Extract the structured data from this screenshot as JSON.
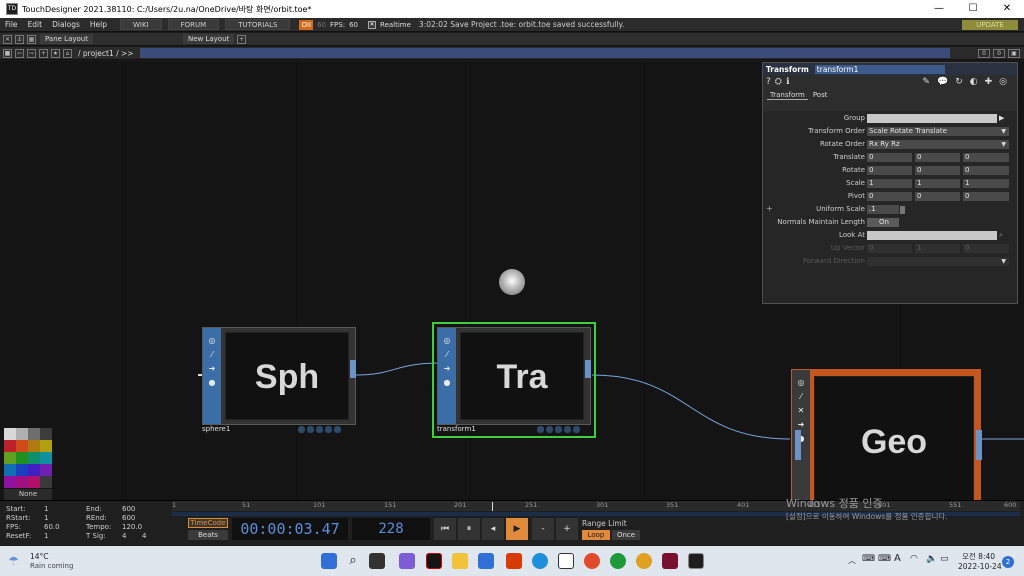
{
  "window": {
    "title": "TouchDesigner 2021.38110: C:/Users/2u.na/OneDrive/바탕 화면/orbit.toe*",
    "app_icon": "TD",
    "minimize": "—",
    "maximize": "☐",
    "close": "✕"
  },
  "menu": {
    "items": [
      "File",
      "Edit",
      "Dialogs",
      "Help"
    ],
    "wiki": "WIKI",
    "forum": "FORUM",
    "tutorials": "TUTORIALS",
    "perf_badge": "OII",
    "perf_value": "60",
    "fps_label": "FPS:",
    "fps_value": "60",
    "realtime_label": "Realtime",
    "status_text": "3:02:02 Save Project .toe: orbit.toe saved successfully.",
    "update": "UPDATE"
  },
  "panebar": {
    "pane_layout": "Pane Layout",
    "new_layout": "New Layout",
    "add": "+"
  },
  "pathbar": {
    "path": "/ project1 / >>",
    "num_a": "0",
    "num_b": "0"
  },
  "nodes": {
    "sphere": {
      "label": "Sph",
      "name": "sphere1"
    },
    "transform": {
      "label": "Tra",
      "name": "transform1"
    },
    "geo": {
      "label": "Geo"
    }
  },
  "params": {
    "op_type": "Transform",
    "op_name": "transform1",
    "tabs": [
      "Transform",
      "Post"
    ],
    "group_label": "Group",
    "group_value": "",
    "transform_order_label": "Transform Order",
    "transform_order_value": "Scale Rotate Translate",
    "rotate_order_label": "Rotate Order",
    "rotate_order_value": "Rx Ry Rz",
    "translate_label": "Translate",
    "translate": [
      "0",
      "0",
      "0"
    ],
    "rotate_label": "Rotate",
    "rotate": [
      "0",
      "0",
      "0"
    ],
    "scale_label": "Scale",
    "scale": [
      "1",
      "1",
      "1"
    ],
    "pivot_label": "Pivot",
    "pivot": [
      "0",
      "0",
      "0"
    ],
    "uniform_scale_label": "Uniform Scale",
    "uniform_scale_value": ".1",
    "normals_label": "Normals Maintain Length",
    "normals_value": "On",
    "look_at_label": "Look At",
    "up_vector_label": "Up Vector",
    "up_vector": [
      "0",
      "1",
      "0"
    ],
    "forward_label": "Forward Direction",
    "plus": "+"
  },
  "timeline": {
    "start_label": "Start:",
    "start": "1",
    "rstart_label": "RStart:",
    "rstart": "1",
    "fps_label": "FPS:",
    "fps": "60.0",
    "resetf_label": "ResetF:",
    "resetf": "1",
    "end_label": "End:",
    "end": "600",
    "rend_label": "REnd:",
    "rend": "600",
    "tempo_label": "Tempo:",
    "tempo": "120.0",
    "tsig_label": "T Sig:",
    "tsig": [
      "4",
      "4"
    ],
    "ticks": [
      "1",
      "51",
      "101",
      "151",
      "201",
      "251",
      "301",
      "351",
      "401",
      "451",
      "501",
      "551",
      "600"
    ],
    "timecode": "TimeCode",
    "beats": "Beats",
    "time_display": "00:00:03.47",
    "frame_display": "228",
    "range_limit": "Range Limit",
    "loop": "Loop",
    "once": "Once",
    "minus": "-",
    "plus": "+"
  },
  "swatch_none": "None",
  "watermark": {
    "line1": "Windows 정품 인증",
    "line2": "[설정]으로 이동하여 Windows를 정품 인증합니다."
  },
  "taskbar": {
    "weather_temp": "14°C",
    "weather_desc": "Rain coming",
    "ime": "A",
    "time": "오전 8:40",
    "date": "2022-10-24",
    "notif_count": "2"
  }
}
